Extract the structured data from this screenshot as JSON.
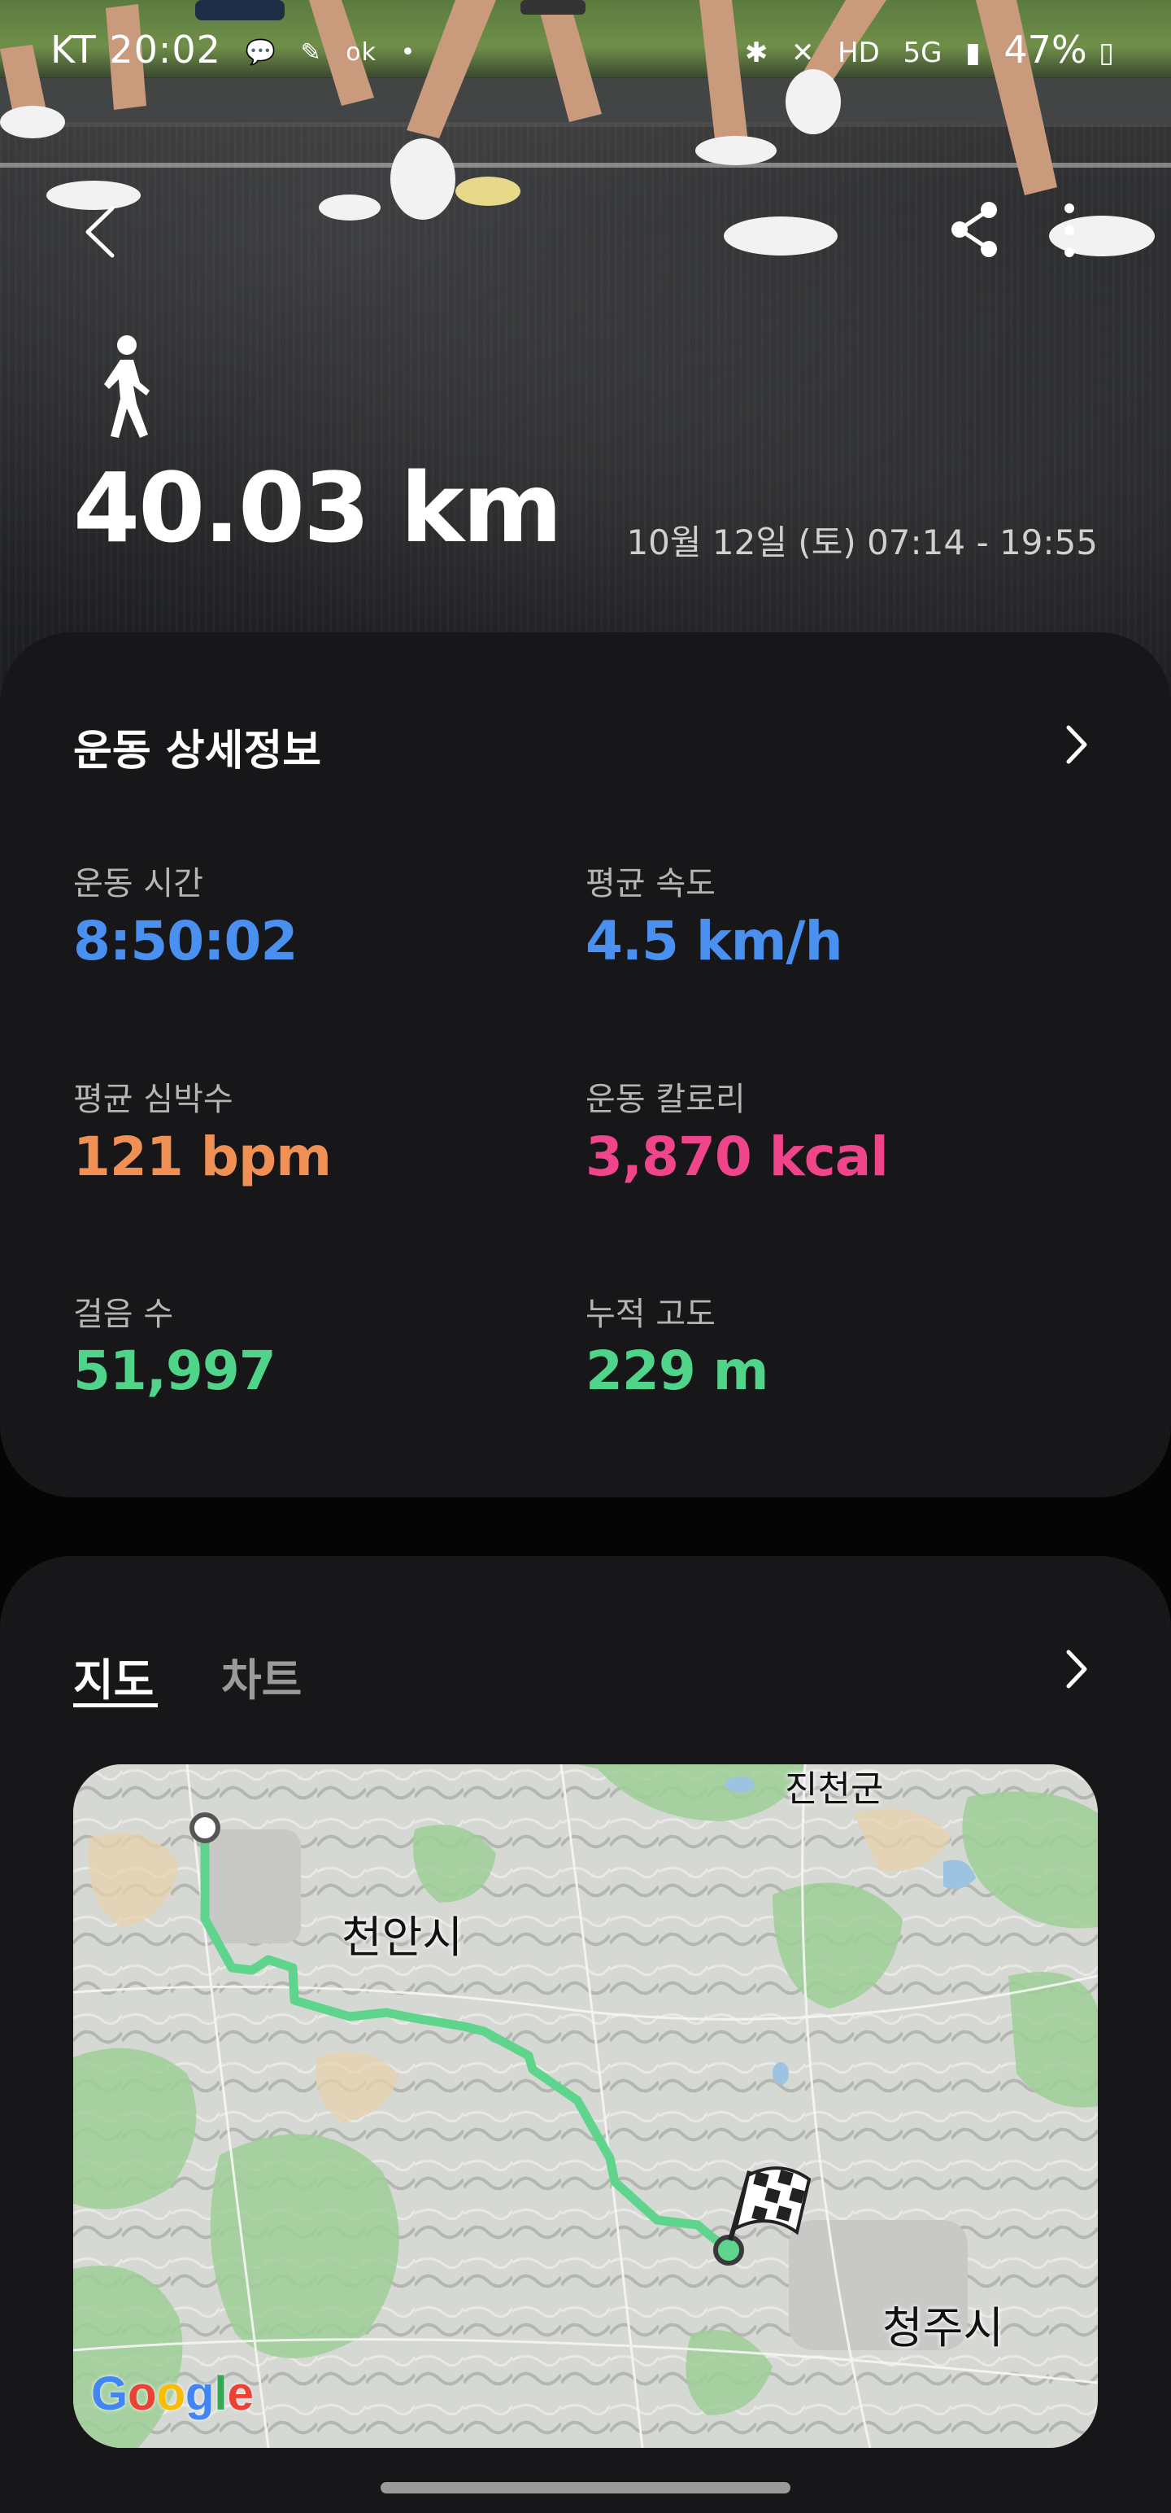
{
  "status_bar": {
    "carrier_time": "KT 20:02",
    "app_icons": [
      "talk-icon",
      "feather-icon",
      "ok-icon",
      "dot-icon"
    ],
    "system_icons": [
      "bluetooth-icon",
      "mute-icon",
      "hd-icon",
      "5g-icon",
      "signal-icon"
    ],
    "battery": "47%"
  },
  "header": {
    "activity_icon": "walking-person-icon",
    "distance": "40.03 km",
    "datetime": "10월 12일 (토) 07:14 - 19:55"
  },
  "details": {
    "title": "운동 상세정보",
    "stats": [
      {
        "label": "운동 시간",
        "value": "8:50:02",
        "color": "#4a90f0"
      },
      {
        "label": "평균 속도",
        "value": "4.5 km/h",
        "color": "#4a90f0"
      },
      {
        "label": "평균 심박수",
        "value": "121 bpm",
        "color": "#f09055"
      },
      {
        "label": "운동 칼로리",
        "value": "3,870 kcal",
        "color": "#f0458a"
      },
      {
        "label": "걸음 수",
        "value": "51,997",
        "color": "#4fd48a"
      },
      {
        "label": "누적 고도",
        "value": "229 m",
        "color": "#4fd48a"
      }
    ]
  },
  "map_section": {
    "tabs": [
      {
        "label": "지도",
        "active": true
      },
      {
        "label": "차트",
        "active": false
      }
    ],
    "place_labels": [
      "진천군",
      "천안시",
      "청주시"
    ],
    "logo": "Google",
    "route_color": "#5fd48c"
  }
}
